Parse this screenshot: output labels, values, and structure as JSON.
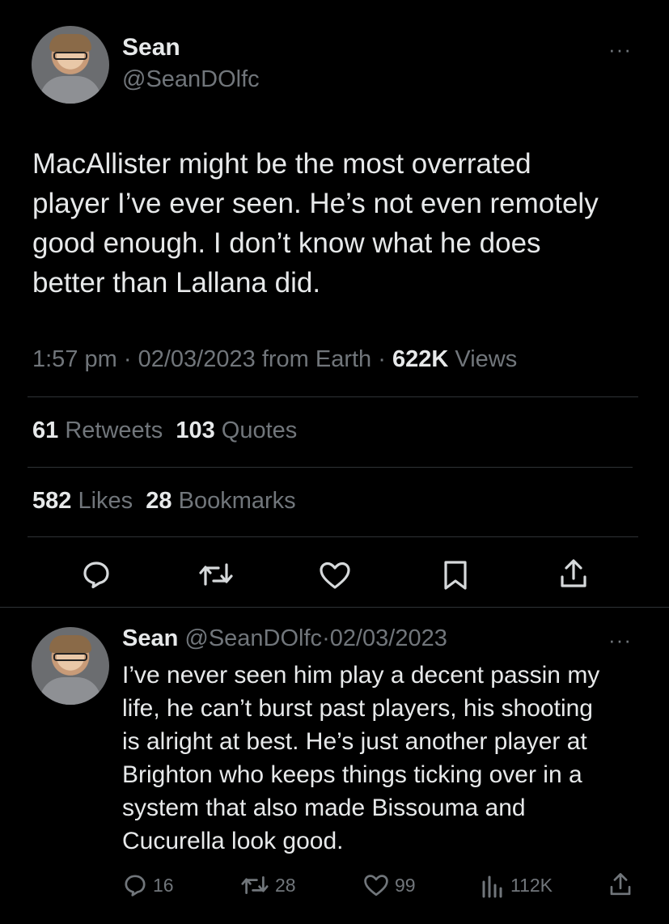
{
  "tweet": {
    "author_name": "Sean",
    "author_handle": "@SeanDOlfc",
    "more_label": "···",
    "text": "MacAllister might be the most overrated\nplayer I’ve ever seen. He’s not even remotely\ngood enough. I don’t know what he does\nbetter than Lallana did.",
    "time": "1:57 pm",
    "date": "02/03/2023",
    "location": "from Earth",
    "views_count": "622K",
    "views_label": "Views",
    "retweets_count": "61",
    "retweets_label": "Retweets",
    "quotes_count": "103",
    "quotes_label": "Quotes",
    "likes_count": "582",
    "likes_label": "Likes",
    "bookmarks_count": "28",
    "bookmarks_label": "Bookmarks"
  },
  "actions": {
    "icons": [
      "reply-icon",
      "retweet-icon",
      "like-icon",
      "bookmark-icon",
      "share-icon"
    ]
  },
  "reply": {
    "author_name": "Sean",
    "author_handle": "@SeanDOlfc",
    "date": "02/03/2023",
    "more_label": "···",
    "text": "I’ve never seen him play a decent passin my\nlife, he can’t burst past players, his shooting\nis alright at best. He’s just another player at\nBrighton who keeps things ticking over in a\nsystem that also made Bissouma and\nCucurella look good.",
    "replies": "16",
    "retweets": "28",
    "likes": "99",
    "views": "112K"
  },
  "colors": {
    "background": "#000000",
    "text": "#e7e9ea",
    "secondary": "#71767b",
    "divider": "#2f3336"
  }
}
